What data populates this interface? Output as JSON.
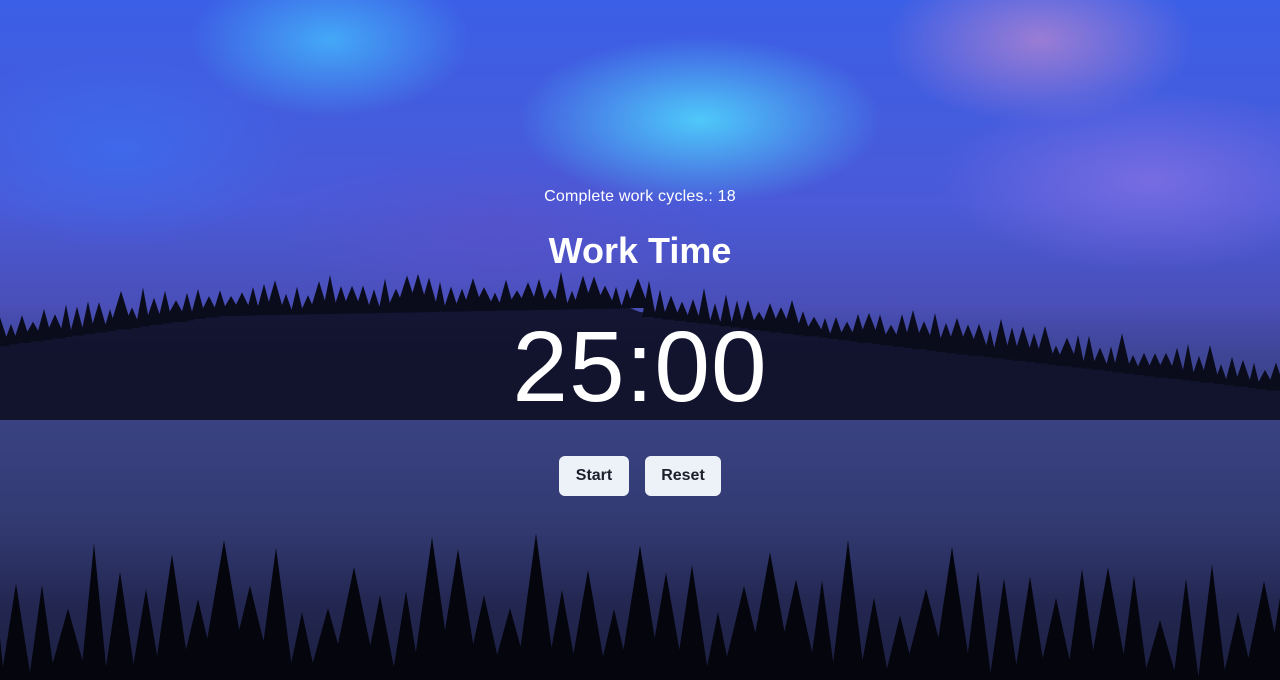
{
  "background": {
    "description_icon": "forest-fog-background",
    "colors": {
      "sky_top": "#3b5fe6",
      "sky_glow": "#50dcff",
      "mist": "#4a4fb8",
      "tree_silhouette": "#05060f"
    }
  },
  "pomodoro": {
    "cycles_label": "Complete work cycles.:",
    "cycles_count": "18",
    "mode_title": "Work Time",
    "time": "25:00"
  },
  "controls": {
    "start_label": "Start",
    "reset_label": "Reset"
  },
  "colors": {
    "text": "#ffffff",
    "button_bg": "#edf1f8",
    "button_text": "#1a202c"
  }
}
